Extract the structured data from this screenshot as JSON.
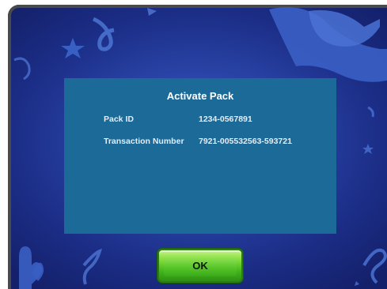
{
  "dialog": {
    "title": "Activate Pack",
    "rows": [
      {
        "label": "Pack ID",
        "value": "1234-0567891"
      },
      {
        "label": "Transaction Number",
        "value": "7921-005532563-593721"
      }
    ]
  },
  "buttons": {
    "ok_label": "OK"
  },
  "colors": {
    "background": "#2a45a8",
    "dialog": "#1c6a98",
    "ok_button": "#55c52a",
    "frame": "#4a4a4a"
  }
}
